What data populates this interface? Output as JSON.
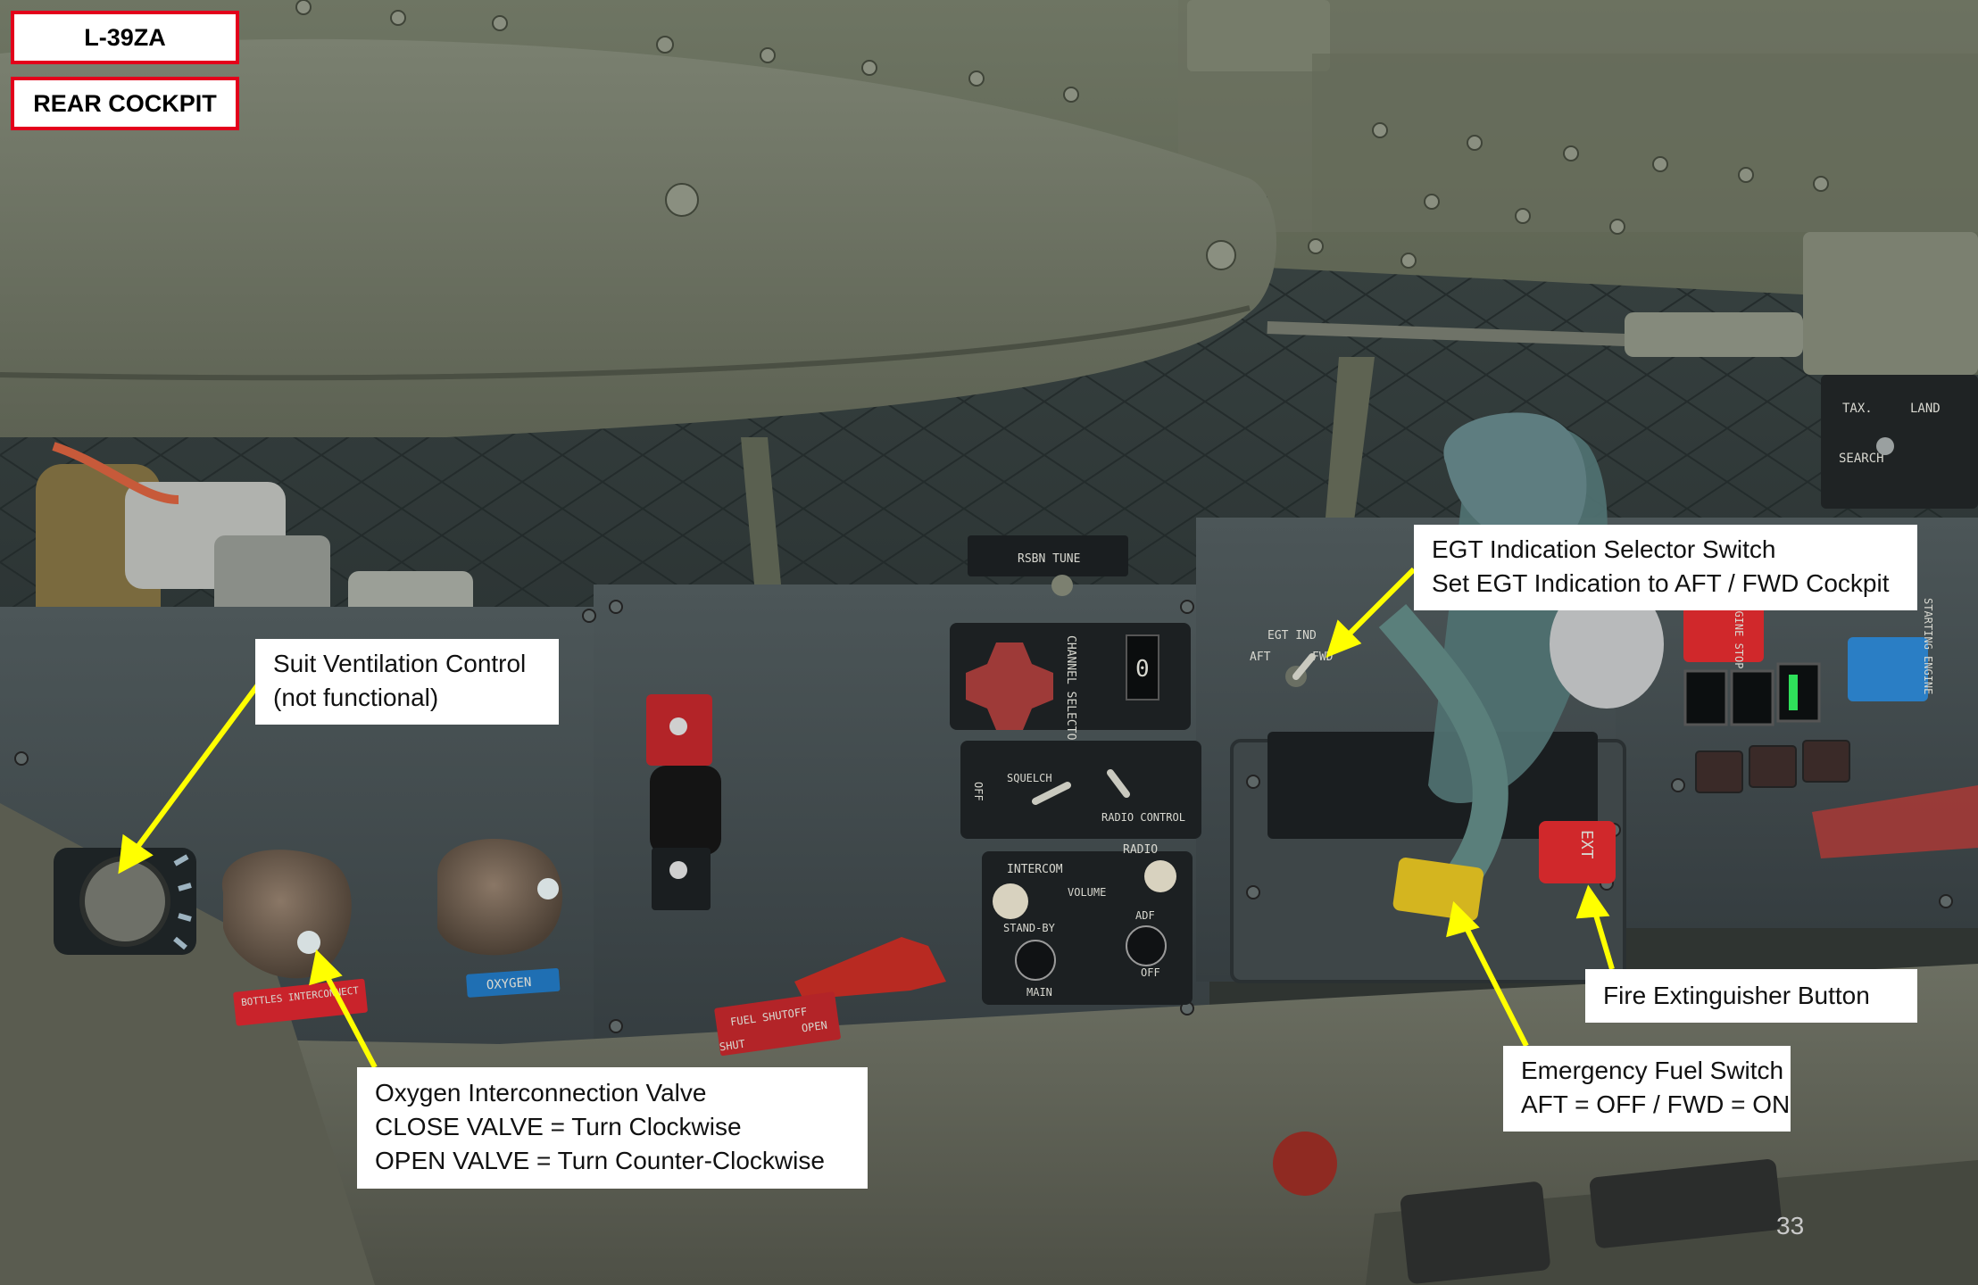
{
  "header": {
    "aircraft": "L-39ZA",
    "section": "REAR COCKPIT"
  },
  "callouts": [
    {
      "id": "suit-ventilation",
      "lines": [
        "Suit Ventilation Control",
        "(not functional)"
      ]
    },
    {
      "id": "egt-selector",
      "lines": [
        "EGT Indication Selector Switch",
        "Set EGT Indication to AFT / FWD Cockpit"
      ]
    },
    {
      "id": "oxygen-valve",
      "lines": [
        "Oxygen Interconnection Valve",
        "CLOSE VALVE = Turn Clockwise",
        "OPEN VALVE = Turn Counter-Clockwise"
      ]
    },
    {
      "id": "fire-extinguisher",
      "lines": [
        "Fire Extinguisher Button"
      ]
    },
    {
      "id": "emergency-fuel",
      "lines": [
        "Emergency Fuel Switch",
        "AFT = OFF / FWD = ON"
      ]
    }
  ],
  "panel_labels": {
    "rsbn_tune": "RSBN TUNE",
    "egt_ind": "EGT IND",
    "egt_aft": "AFT",
    "egt_fwd": "FWD",
    "channel_selector": "CHANNEL SELECTOR",
    "channel_digit": "0",
    "squelch": "SQUELCH",
    "off": "OFF",
    "radio_control": "RADIO CONTROL",
    "intercom": "INTERCOM",
    "radio": "RADIO",
    "volume": "VOLUME",
    "stand_by": "STAND-BY",
    "adf": "ADF",
    "main": "MAIN",
    "ext": "EXT",
    "bottles_interconnect": "BOTTLES INTERCONNECT",
    "oxygen": "OXYGEN",
    "fuel_shutoff": "FUEL SHUTOFF",
    "shut": "SHUT",
    "open": "OPEN",
    "tax": "TAX.",
    "land": "LAND",
    "search": "SEARCH",
    "starting_engine": "STARTING ENGINE",
    "engine_stop": "ENGINE STOP"
  },
  "footer": {
    "page_number": "33"
  },
  "colors": {
    "title_border": "#e3001b",
    "arrow": "#ffff00",
    "callout_bg": "#ffffff"
  }
}
